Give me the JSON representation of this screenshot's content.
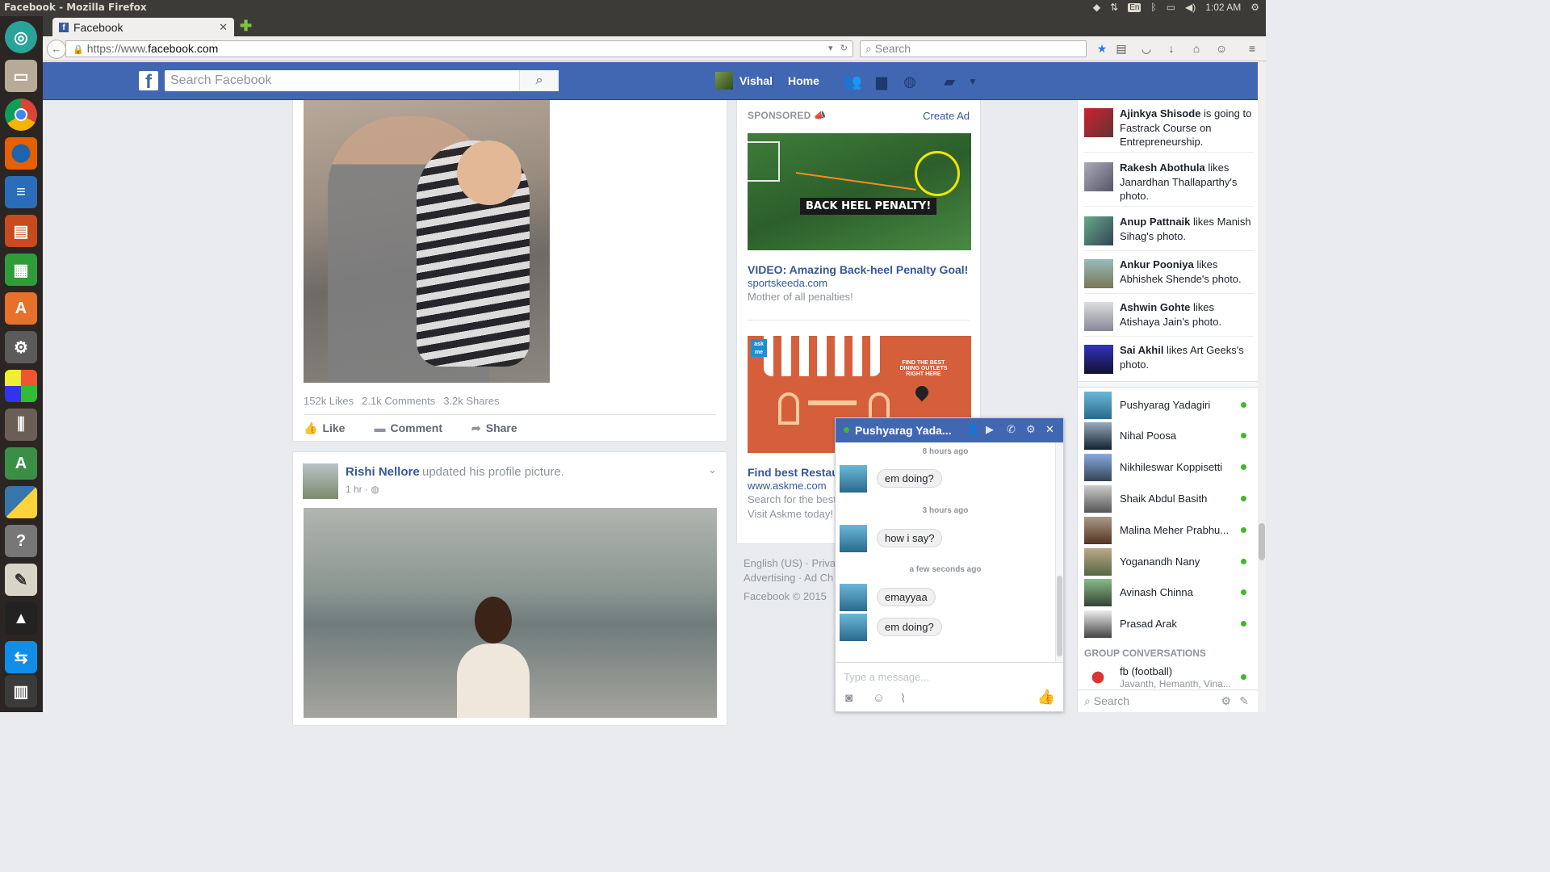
{
  "os": {
    "window_title": "Facebook - Mozilla Firefox",
    "keyboard": "En",
    "time": "1:02 AM"
  },
  "launcher": {
    "apps": [
      "ubuntu-dash-icon",
      "files-icon",
      "chrome-icon",
      "firefox-icon",
      "writer-icon",
      "impress-icon",
      "calc-icon",
      "software-center-icon",
      "system-settings-icon",
      "color-app-icon",
      "mixer-icon",
      "android-studio-icon",
      "python-icon",
      "help-icon",
      "image-viewer-icon",
      "inkscape-icon",
      "teamviewer-icon",
      "trash-icon"
    ]
  },
  "browser": {
    "tab_title": "Facebook",
    "url_prefix": "https://www.",
    "url_domain": "facebook.com",
    "search_placeholder": "Search"
  },
  "fb_header": {
    "logo": "f",
    "search_placeholder": "Search Facebook",
    "user_name": "Vishal",
    "home_label": "Home"
  },
  "post1": {
    "likes": "152k Likes",
    "comments": "2.1k Comments",
    "shares": "3.2k Shares",
    "like_label": "Like",
    "comment_label": "Comment",
    "share_label": "Share"
  },
  "post2": {
    "author": "Rishi Nellore",
    "action": "updated his profile picture.",
    "time": "1 hr ·"
  },
  "sponsored": {
    "header": "SPONSORED",
    "create_ad": "Create Ad",
    "ad1": {
      "image_caption": "BACK HEEL PENALTY!",
      "title": "VIDEO: Amazing Back-heel Penalty Goal!",
      "url": "sportskeeda.com",
      "desc": "Mother of all penalties!"
    },
    "ad2": {
      "image_text": "FIND THE BEST DINING OUTLETS RIGHT HERE",
      "badge": "ask me",
      "title": "Find best Restaur",
      "url": "www.askme.com",
      "desc1": "Search for the best",
      "desc2": "Visit Askme today!"
    }
  },
  "footer": {
    "line1": "English (US) · Priva",
    "line2": "Advertising · Ad Ch",
    "line3": "Facebook © 2015"
  },
  "ticker": [
    {
      "name": "Ajinkya Shisode",
      "text": " is going to Fastrack Course on Entrepreneurship."
    },
    {
      "name": "Rakesh Abothula",
      "text": " likes Janardhan Thallaparthy's photo."
    },
    {
      "name": "Anup Pattnaik",
      "text": " likes Manish Sihag's photo."
    },
    {
      "name": "Ankur Pooniya",
      "text": " likes Abhishek Shende's photo."
    },
    {
      "name": "Ashwin Gohte",
      "text": " likes Atishaya Jain's photo."
    },
    {
      "name": "Sai Akhil",
      "text": " likes Art Geeks's photo."
    }
  ],
  "friends": [
    "Pushyarag Yadagiri",
    "Nihal Poosa",
    "Nikhileswar Koppisetti",
    "Shaik Abdul Basith",
    "Malina Meher Prabhu...",
    "Yoganandh Nany",
    "Avinash Chinna",
    "Prasad Arak"
  ],
  "group_conversations": {
    "header": "GROUP CONVERSATIONS",
    "name": "fb (football)",
    "members": "Javanth, Hemanth, Vina..."
  },
  "chat_search_placeholder": "Search",
  "chat": {
    "name": "Pushyarag Yada...",
    "ts1": "8 hours ago",
    "m1": "em doing?",
    "ts2": "3 hours ago",
    "m2": "how i say?",
    "ts3": "a few seconds ago",
    "m3": "emayyaa",
    "m4": "em doing?",
    "input_placeholder": "Type a message..."
  },
  "colors": {
    "fb_blue": "#4267b2",
    "link_blue": "#365899",
    "online_green": "#42b72a"
  }
}
